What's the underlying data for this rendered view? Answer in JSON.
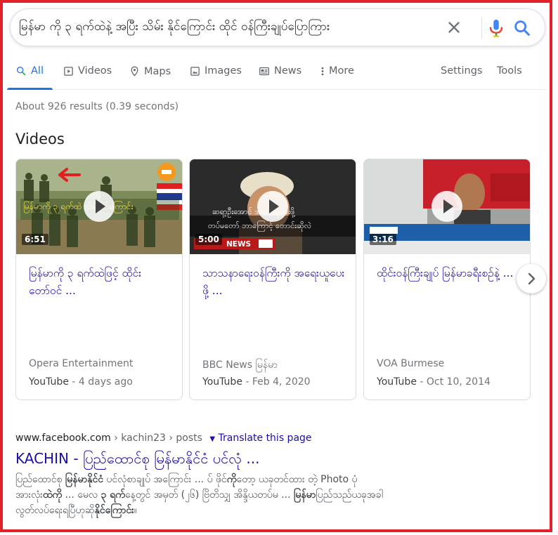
{
  "search": {
    "query": "မြန်မာ ကို ၃ ရက်ထဲနဲ့ အပြီး သိမ်း နိုင်ကြောင်း ထိုင် ဝန်ကြီးချုပ်ပြောကြား"
  },
  "tabs": [
    {
      "label": "All",
      "icon": "search-icon",
      "active": true
    },
    {
      "label": "Videos",
      "icon": "play-video-icon"
    },
    {
      "label": "Maps",
      "icon": "map-pin-icon"
    },
    {
      "label": "Images",
      "icon": "image-icon"
    },
    {
      "label": "News",
      "icon": "news-icon"
    },
    {
      "label": "More",
      "icon": "more-vert-icon"
    }
  ],
  "tools": {
    "settings": "Settings",
    "tools": "Tools"
  },
  "results_stats": "About 926 results (0.39 seconds)",
  "videos_section": {
    "title": "Videos",
    "cards": [
      {
        "duration": "6:51",
        "title": "မြန်မာကို ၃ ရက်ထဲဖြင့် ထိုင်းတော်ဝင် ...",
        "source": "Opera Entertainment",
        "platform": "YouTube",
        "date": " - 4 days ago",
        "overlay_text": "မြန်မာကို ၃ ရက်ထဲ သိမ်းနိုင်ကြောင်း"
      },
      {
        "duration": "5:00",
        "title": "သာသနာရေးဝန်ကြီးကို အရေးယူပေးဖို့ ...",
        "source": "BBC News မြန်မာ",
        "platform": "YouTube",
        "date": " - Feb 4, 2020",
        "overlay_text": "ဆရာ့ဦးအောင် အရေးယူပေးဖို့",
        "overlay_text2": "တပ်မတော် ဘာကြောင့် တောင်းဆိုလဲ",
        "news_label": "NEWS"
      },
      {
        "duration": "3:16",
        "title": "ထိုင်းဝန်ကြီးချုပ် မြန်မာခရီးစဉ်နဲ့ ...",
        "source": "VOA Burmese",
        "platform": "YouTube",
        "date": " - Oct 10, 2014"
      }
    ]
  },
  "result": {
    "url_domain": "www.facebook.com",
    "url_path": " › kachin23 › posts",
    "translate": "Translate this page",
    "title": "KACHIN - ပြည်ထောင်စု မြန်မာနိုင်ငံ ပင်လုံ ...",
    "snippet": [
      "ပြည်ထောင်စု ",
      "မြန်မာနိုင်ငံ",
      " ပင်လုံစာချုပ် အကြောင်း ... ပ် ဖိုင်",
      "ကို",
      "တော့ ယခုတင်ထား တဲ့ Photo ပုံ",
      "အားလုံး",
      "ထဲကို",
      " ... မေလ ",
      "၃ ရက်",
      "နေ့တွင် အမှတ် (၂၆) ဗြိတိသျှ အိန္ဒိယတပ်မ ... ",
      "မြန်မာ",
      "ပြည်သည်ယခုအခါ",
      "လွတ်လပ်ရေးရပြီဟုဆို",
      "နိုင်ကြောင်း",
      "။"
    ]
  },
  "colors": {
    "accent": "#1a73e8",
    "link": "#1a0dab",
    "frame": "#e3212b"
  }
}
